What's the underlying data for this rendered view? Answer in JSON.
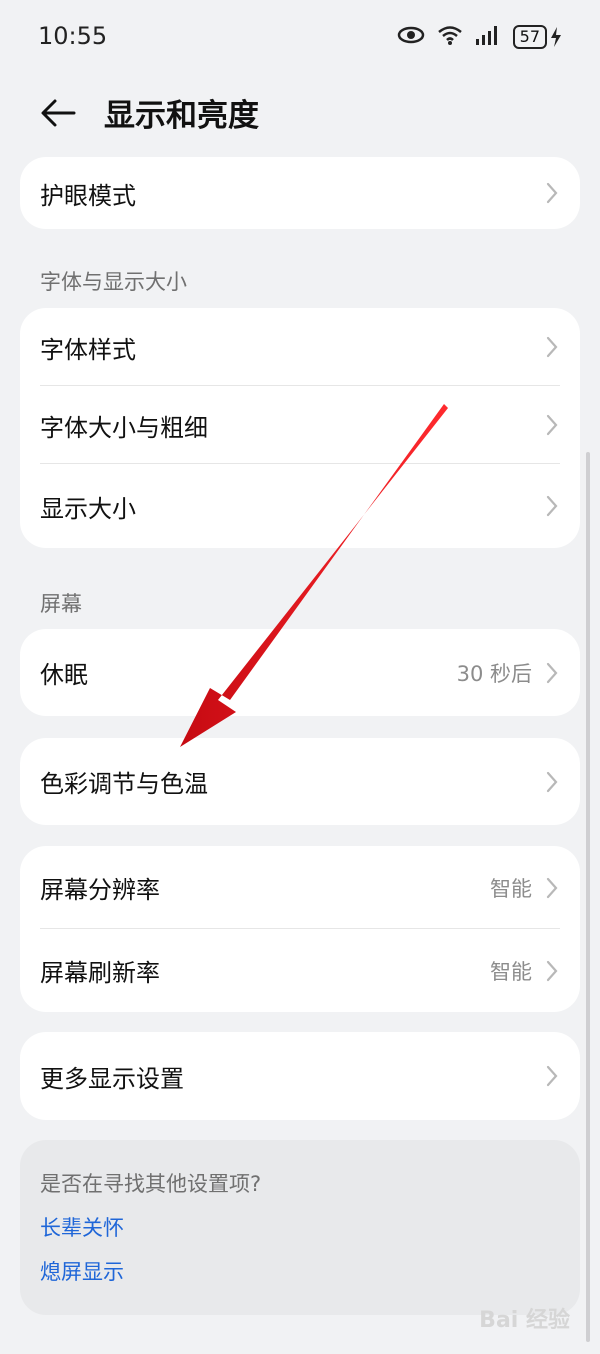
{
  "status_bar": {
    "time": "10:55",
    "battery": "57",
    "icons": [
      "eye-icon",
      "wifi-icon",
      "signal-icon",
      "battery-icon",
      "charging-icon"
    ]
  },
  "header": {
    "title": "显示和亮度",
    "back_icon": "back-arrow-icon"
  },
  "card_eye": {
    "items": [
      {
        "label": "护眼模式"
      }
    ]
  },
  "font_section": {
    "label": "字体与显示大小",
    "items": [
      {
        "label": "字体样式"
      },
      {
        "label": "字体大小与粗细"
      },
      {
        "label": "显示大小"
      }
    ]
  },
  "screen_section": {
    "label": "屏幕",
    "sleep": {
      "label": "休眠",
      "value": "30 秒后"
    },
    "color": {
      "label": "色彩调节与色温"
    },
    "resolution": {
      "label": "屏幕分辨率",
      "value": "智能"
    },
    "refresh": {
      "label": "屏幕刷新率",
      "value": "智能"
    },
    "more": {
      "label": "更多显示设置"
    }
  },
  "suggest": {
    "title": "是否在寻找其他设置项?",
    "links": [
      "长辈关怀",
      "熄屏显示"
    ]
  },
  "colors": {
    "accent_link": "#1f66d8",
    "annotation_arrow": "#e8141c",
    "background": "#f1f2f4"
  },
  "watermark": "Bai 经验"
}
